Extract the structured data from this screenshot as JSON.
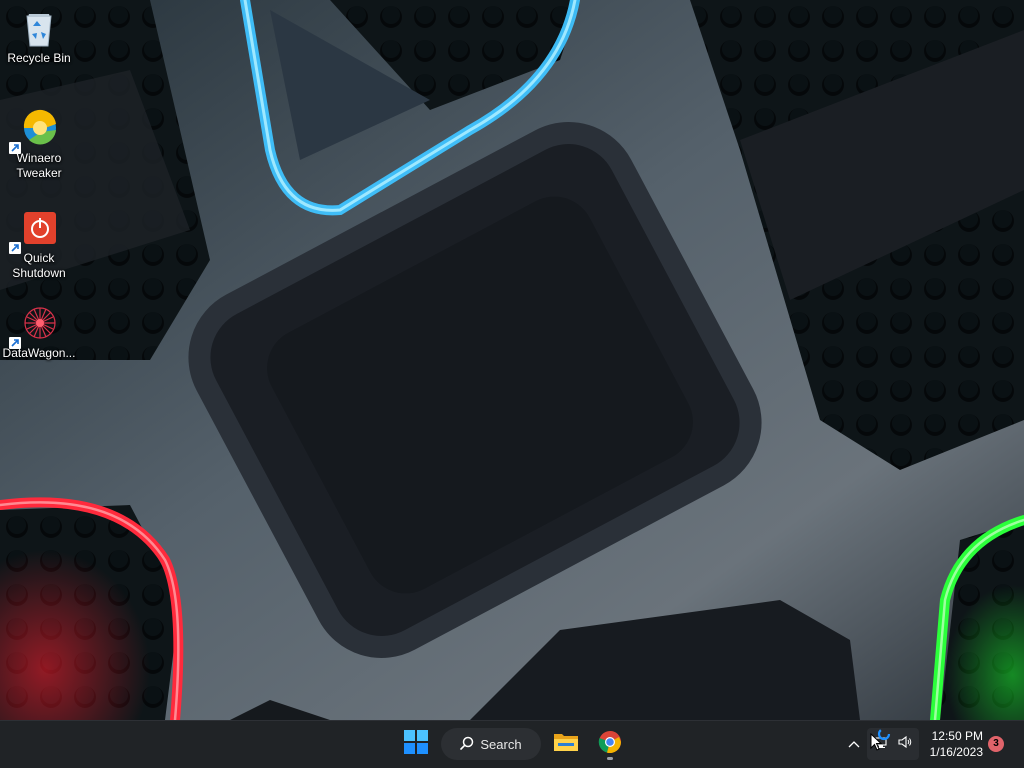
{
  "desktop": {
    "icons": [
      {
        "label": "Recycle Bin",
        "icon": "recycle-bin-icon"
      },
      {
        "label": "Winaero Tweaker",
        "line1": "Winaero",
        "line2": "Tweaker",
        "icon": "winaero-tweaker-icon"
      },
      {
        "label": "Quick Shutdown",
        "line1": "Quick",
        "line2": "Shutdown",
        "icon": "power-icon"
      },
      {
        "label": "DataWagon...",
        "icon": "datawagon-icon"
      }
    ]
  },
  "taskbar": {
    "start_icon": "windows-start-icon",
    "search_label": "Search",
    "pinned": [
      {
        "name": "File Explorer",
        "icon": "folder-icon"
      },
      {
        "name": "Google Chrome",
        "icon": "chrome-icon",
        "running": true
      }
    ],
    "tray": {
      "overflow_icon": "chevron-up-icon",
      "network_icon": "network-icon",
      "volume_icon": "speaker-icon",
      "time": "12:50 PM",
      "date": "1/16/2023",
      "notification_count": "3"
    }
  },
  "colors": {
    "taskbar_bg": "#202326",
    "accent_blue": "#3fc3ff",
    "accent_red": "#ff2a3c",
    "accent_green": "#2bff3a",
    "badge": "#e0636a"
  }
}
